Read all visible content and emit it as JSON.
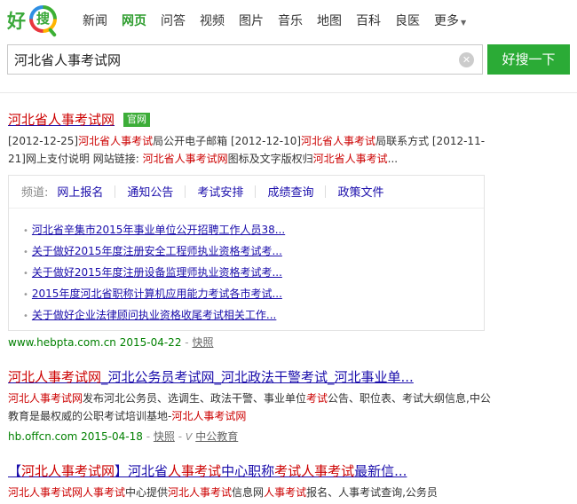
{
  "logo": {
    "left_text": "好",
    "right_text": "搜"
  },
  "nav": [
    {
      "label": "新闻",
      "active": false
    },
    {
      "label": "网页",
      "active": true
    },
    {
      "label": "问答",
      "active": false
    },
    {
      "label": "视频",
      "active": false
    },
    {
      "label": "图片",
      "active": false
    },
    {
      "label": "音乐",
      "active": false
    },
    {
      "label": "地图",
      "active": false
    },
    {
      "label": "百科",
      "active": false
    },
    {
      "label": "良医",
      "active": false
    },
    {
      "label": "更多",
      "active": false
    }
  ],
  "search": {
    "query": "河北省人事考试网",
    "button_label": "好搜一下",
    "clear_symbol": "✕"
  },
  "results": [
    {
      "title": "河北省人事考试网",
      "badge": "官网",
      "desc": [
        {
          "t": "[2012-12-25]",
          "h": false
        },
        {
          "t": "河北省人事考试",
          "h": true
        },
        {
          "t": "局公开电子邮箱 [2012-12-10]",
          "h": false
        },
        {
          "t": "河北省人事考试",
          "h": true
        },
        {
          "t": "局联系方式 [2012-11-21]网上支付说明 网站链接: ",
          "h": false
        },
        {
          "t": "河北省人事考试网",
          "h": true
        },
        {
          "t": "图标及文字版权归",
          "h": false
        },
        {
          "t": "河北省人事考试",
          "h": true
        },
        {
          "t": "...",
          "h": false
        }
      ],
      "channel_label": "频道:",
      "channels": [
        "网上报名",
        "通知公告",
        "考试安排",
        "成绩查询",
        "政策文件"
      ],
      "sublinks": [
        "河北省辛集市2015年事业单位公开招聘工作人员38...",
        "关于做好2015年度注册安全工程师执业资格考试考...",
        "关于做好2015年度注册设备监理师执业资格考试考...",
        "2015年度河北省职称计算机应用能力考试各市考试...",
        "关于做好企业法律顾问执业资格收尾考试相关工作..."
      ],
      "url": "www.hebpta.com.cn 2015-04-22",
      "snapshot": "快照"
    },
    {
      "title": [
        {
          "t": "河北人事考试网",
          "h": true
        },
        {
          "t": "_河北公务员考试网_河北政法干警考试_河北事业单...",
          "h": false
        }
      ],
      "desc": [
        {
          "t": "河北人事考试网",
          "h": true
        },
        {
          "t": "发布河北公务员、选调生、政法干警、事业单位",
          "h": false
        },
        {
          "t": "考试",
          "h": true
        },
        {
          "t": "公告、职位表、考试大纲信息,中公教育是最权威的公职考试培训基地-",
          "h": false
        },
        {
          "t": "河北人事考试网",
          "h": true
        }
      ],
      "url": "hb.offcn.com 2015-04-18",
      "snapshot": "快照",
      "verified_symbol": "V",
      "verified_label": "中公教育"
    },
    {
      "title": [
        {
          "t": "【",
          "h": false
        },
        {
          "t": "河北人事考试网",
          "h": true
        },
        {
          "t": "】河北省",
          "h": false
        },
        {
          "t": "人事考试",
          "h": true
        },
        {
          "t": "中心职称",
          "h": false
        },
        {
          "t": "考试人事考试",
          "h": true
        },
        {
          "t": "最新信...",
          "h": false
        }
      ],
      "desc": [
        {
          "t": "河北人事考试网人事考试",
          "h": true
        },
        {
          "t": "中心提供",
          "h": false
        },
        {
          "t": "河北人事考试",
          "h": true
        },
        {
          "t": "信息网",
          "h": false
        },
        {
          "t": "人事考试",
          "h": true
        },
        {
          "t": "报名、人事考试查询,公务员",
          "h": false
        }
      ]
    }
  ]
}
